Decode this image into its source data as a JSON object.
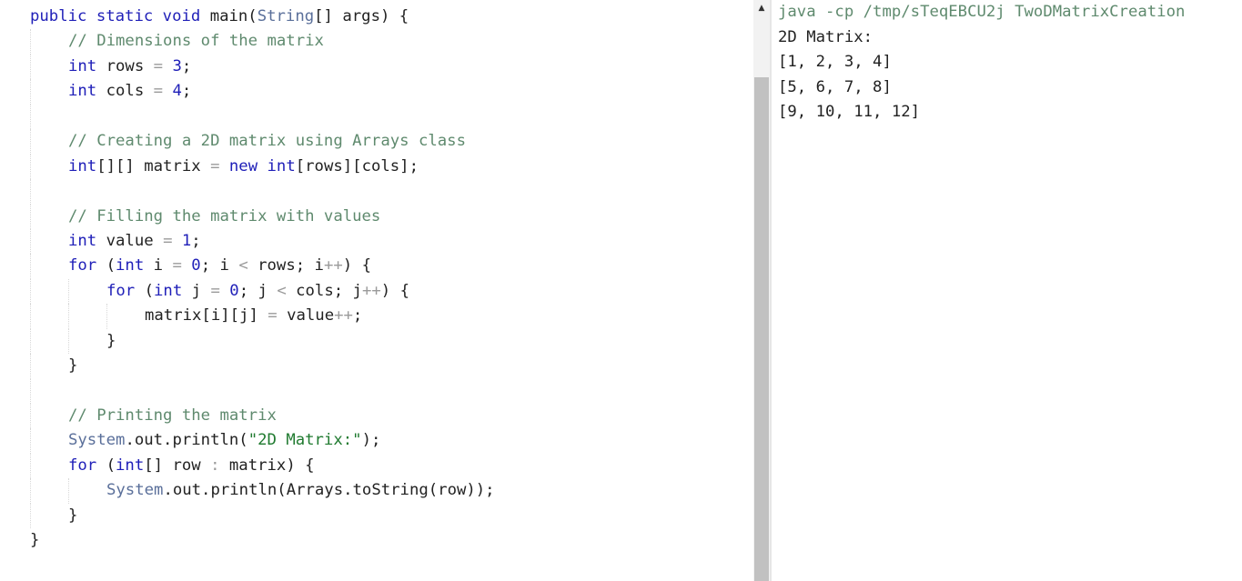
{
  "editor": {
    "lines": [
      {
        "indent": 0,
        "parts": [
          {
            "t": "public static void ",
            "c": "kw"
          },
          {
            "t": "main(",
            "c": ""
          },
          {
            "t": "String",
            "c": "ty"
          },
          {
            "t": "[] args) {",
            "c": ""
          }
        ]
      },
      {
        "indent": 1,
        "parts": [
          {
            "t": "// Dimensions of the matrix",
            "c": "cm"
          }
        ]
      },
      {
        "indent": 1,
        "parts": [
          {
            "t": "int",
            "c": "kw"
          },
          {
            "t": " rows ",
            "c": ""
          },
          {
            "t": "=",
            "c": "op"
          },
          {
            "t": " ",
            "c": ""
          },
          {
            "t": "3",
            "c": "num"
          },
          {
            "t": ";",
            "c": ""
          }
        ]
      },
      {
        "indent": 1,
        "parts": [
          {
            "t": "int",
            "c": "kw"
          },
          {
            "t": " cols ",
            "c": ""
          },
          {
            "t": "=",
            "c": "op"
          },
          {
            "t": " ",
            "c": ""
          },
          {
            "t": "4",
            "c": "num"
          },
          {
            "t": ";",
            "c": ""
          }
        ]
      },
      {
        "indent": 1,
        "parts": []
      },
      {
        "indent": 1,
        "parts": [
          {
            "t": "// Creating a 2D matrix using Arrays class",
            "c": "cm"
          }
        ]
      },
      {
        "indent": 1,
        "parts": [
          {
            "t": "int",
            "c": "kw"
          },
          {
            "t": "[][] matrix ",
            "c": ""
          },
          {
            "t": "=",
            "c": "op"
          },
          {
            "t": " ",
            "c": ""
          },
          {
            "t": "new",
            "c": "kw"
          },
          {
            "t": " ",
            "c": ""
          },
          {
            "t": "int",
            "c": "kw"
          },
          {
            "t": "[rows][cols];",
            "c": ""
          }
        ]
      },
      {
        "indent": 1,
        "parts": []
      },
      {
        "indent": 1,
        "parts": [
          {
            "t": "// Filling the matrix with values",
            "c": "cm"
          }
        ]
      },
      {
        "indent": 1,
        "parts": [
          {
            "t": "int",
            "c": "kw"
          },
          {
            "t": " value ",
            "c": ""
          },
          {
            "t": "=",
            "c": "op"
          },
          {
            "t": " ",
            "c": ""
          },
          {
            "t": "1",
            "c": "num"
          },
          {
            "t": ";",
            "c": ""
          }
        ]
      },
      {
        "indent": 1,
        "parts": [
          {
            "t": "for",
            "c": "kw"
          },
          {
            "t": " (",
            "c": ""
          },
          {
            "t": "int",
            "c": "kw"
          },
          {
            "t": " i ",
            "c": ""
          },
          {
            "t": "=",
            "c": "op"
          },
          {
            "t": " ",
            "c": ""
          },
          {
            "t": "0",
            "c": "num"
          },
          {
            "t": "; i ",
            "c": ""
          },
          {
            "t": "<",
            "c": "op"
          },
          {
            "t": " rows; i",
            "c": ""
          },
          {
            "t": "++",
            "c": "op"
          },
          {
            "t": ") {",
            "c": ""
          }
        ]
      },
      {
        "indent": 2,
        "parts": [
          {
            "t": "for",
            "c": "kw"
          },
          {
            "t": " (",
            "c": ""
          },
          {
            "t": "int",
            "c": "kw"
          },
          {
            "t": " j ",
            "c": ""
          },
          {
            "t": "=",
            "c": "op"
          },
          {
            "t": " ",
            "c": ""
          },
          {
            "t": "0",
            "c": "num"
          },
          {
            "t": "; j ",
            "c": ""
          },
          {
            "t": "<",
            "c": "op"
          },
          {
            "t": " cols; j",
            "c": ""
          },
          {
            "t": "++",
            "c": "op"
          },
          {
            "t": ") {",
            "c": ""
          }
        ]
      },
      {
        "indent": 3,
        "parts": [
          {
            "t": "matrix[i][j] ",
            "c": ""
          },
          {
            "t": "=",
            "c": "op"
          },
          {
            "t": " value",
            "c": ""
          },
          {
            "t": "++",
            "c": "op"
          },
          {
            "t": ";",
            "c": ""
          }
        ]
      },
      {
        "indent": 2,
        "parts": [
          {
            "t": "}",
            "c": ""
          }
        ]
      },
      {
        "indent": 1,
        "parts": [
          {
            "t": "}",
            "c": ""
          }
        ]
      },
      {
        "indent": 1,
        "parts": []
      },
      {
        "indent": 1,
        "parts": [
          {
            "t": "// Printing the matrix",
            "c": "cm"
          }
        ]
      },
      {
        "indent": 1,
        "parts": [
          {
            "t": "System",
            "c": "ty"
          },
          {
            "t": ".out.println(",
            "c": ""
          },
          {
            "t": "\"2D Matrix:\"",
            "c": "str"
          },
          {
            "t": ");",
            "c": ""
          }
        ]
      },
      {
        "indent": 1,
        "parts": [
          {
            "t": "for",
            "c": "kw"
          },
          {
            "t": " (",
            "c": ""
          },
          {
            "t": "int",
            "c": "kw"
          },
          {
            "t": "[] row ",
            "c": ""
          },
          {
            "t": ":",
            "c": "op"
          },
          {
            "t": " matrix) {",
            "c": ""
          }
        ]
      },
      {
        "indent": 2,
        "parts": [
          {
            "t": "System",
            "c": "ty"
          },
          {
            "t": ".out.println(Arrays.toString(row));",
            "c": ""
          }
        ]
      },
      {
        "indent": 1,
        "parts": [
          {
            "t": "}",
            "c": ""
          }
        ]
      },
      {
        "indent": 0,
        "parts": [
          {
            "t": "}",
            "c": ""
          }
        ]
      }
    ]
  },
  "output": {
    "command": "java -cp /tmp/sTeqEBCU2j TwoDMatrixCreation",
    "lines": [
      "2D Matrix:",
      "[1, 2, 3, 4]",
      "[5, 6, 7, 8]",
      "[9, 10, 11, 12]"
    ]
  },
  "scrollbar": {
    "up_arrow": "▲"
  }
}
